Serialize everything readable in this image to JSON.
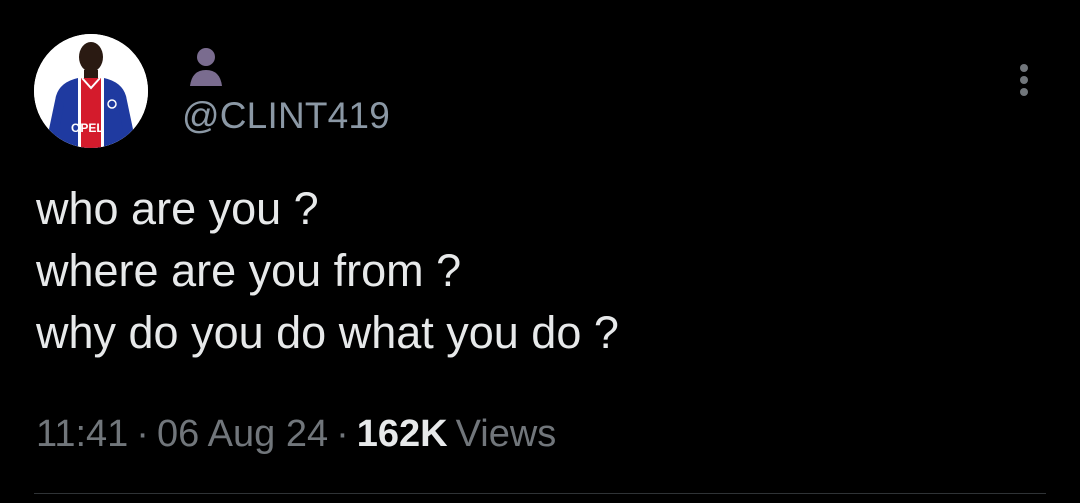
{
  "author": {
    "handle": "@CLINT419",
    "avatar_icon": "football-player-avatar",
    "display_name_icon": "person-silhouette-icon",
    "name_icon_color": "#7a6c8f",
    "jersey_text": "OPEL"
  },
  "tweet": {
    "lines": [
      "who are you ?",
      "where are you from ?",
      "why do you do what you do ?"
    ]
  },
  "meta": {
    "time": "11:41",
    "separator": "·",
    "date": "06 Aug 24",
    "views_count": "162K",
    "views_label": "Views"
  },
  "colors": {
    "background": "#000000",
    "text_primary": "#e7e9ea",
    "text_secondary": "#71767b",
    "handle": "#8b98a5",
    "divider": "#2f3336"
  }
}
